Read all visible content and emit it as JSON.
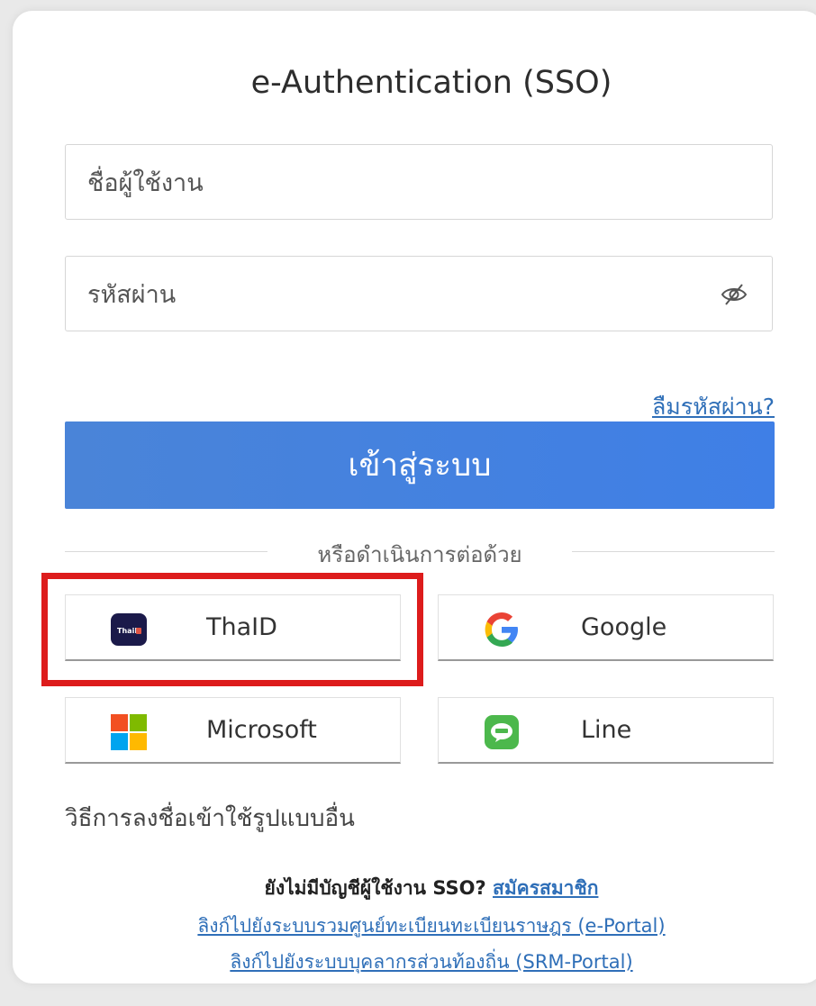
{
  "title": "e-Authentication (SSO)",
  "username": {
    "placeholder": "ชื่อผู้ใช้งาน",
    "value": ""
  },
  "password": {
    "placeholder": "รหัสผ่าน",
    "value": ""
  },
  "forgot_password": "ลืมรหัสผ่าน?",
  "login_button": "เข้าสู่ระบบ",
  "divider_text": "หรือดำเนินการต่อด้วย",
  "social": {
    "thaid": {
      "label": "ThaID",
      "icon_text": "ThaiD"
    },
    "google": {
      "label": "Google"
    },
    "microsoft": {
      "label": "Microsoft"
    },
    "line": {
      "label": "Line"
    }
  },
  "other_methods": "วิธีการลงชื่อเข้าใช้รูปแบบอื่น",
  "register": {
    "question": "ยังไม่มีบัญชีผู้ใช้งาน SSO?",
    "link": "สมัครสมาชิก"
  },
  "portal_links": [
    "ลิงก์ไปยังระบบรวมศูนย์ทะเบียนทะเบียนราษฎร (e-Portal)",
    "ลิงก์ไปยังระบบบุคลากรส่วนท้องถิ่น (SRM-Portal)"
  ],
  "colors": {
    "primary": "#3f7fe6",
    "link": "#2f6fb8",
    "highlight": "#dd1c1c"
  }
}
